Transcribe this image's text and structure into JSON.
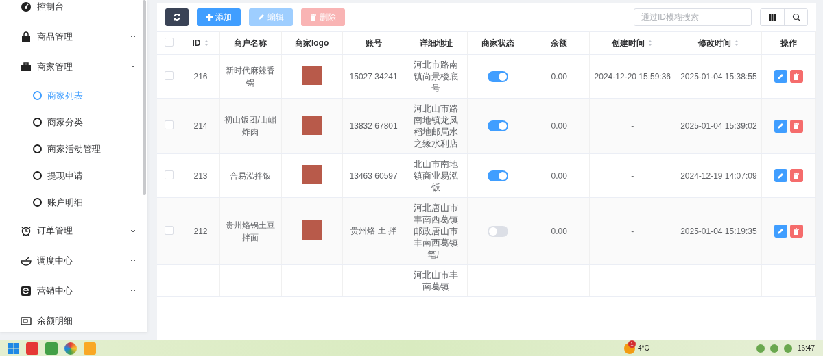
{
  "sidebar": {
    "items": [
      {
        "label": "控制台",
        "kind": "link"
      },
      {
        "label": "商品管理",
        "kind": "group",
        "expanded": false
      },
      {
        "label": "商家管理",
        "kind": "group",
        "expanded": true,
        "children": [
          {
            "label": "商家列表",
            "selected": true
          },
          {
            "label": "商家分类",
            "selected": false
          },
          {
            "label": "商家活动管理",
            "selected": false
          },
          {
            "label": "提现申请",
            "selected": false
          },
          {
            "label": "账户明细",
            "selected": false
          }
        ]
      },
      {
        "label": "订单管理",
        "kind": "group",
        "expanded": false
      },
      {
        "label": "调度中心",
        "kind": "group",
        "expanded": false
      },
      {
        "label": "营销中心",
        "kind": "group",
        "expanded": false
      },
      {
        "label": "余额明细",
        "kind": "link"
      }
    ]
  },
  "toolbar": {
    "buttons": [
      {
        "kind": "refresh",
        "disabled": false
      },
      {
        "kind": "add",
        "label": "添加",
        "disabled": false
      },
      {
        "kind": "edit",
        "label": "编辑",
        "disabled": true
      },
      {
        "kind": "delete",
        "label": "删除",
        "disabled": true
      }
    ],
    "search": {
      "placeholder": "通过ID模糊搜索"
    }
  },
  "table": {
    "select_all_checked": false,
    "columns": [
      {
        "label": "ID",
        "sortable": true
      },
      {
        "label": "商户名称",
        "sortable": false
      },
      {
        "label": "商家logo",
        "sortable": false
      },
      {
        "label": "账号",
        "sortable": false
      },
      {
        "label": "详细地址",
        "sortable": false
      },
      {
        "label": "商家状态",
        "sortable": false
      },
      {
        "label": "余额",
        "sortable": false
      },
      {
        "label": "创建时间",
        "sortable": true
      },
      {
        "label": "修改时间",
        "sortable": true
      },
      {
        "label": "操作",
        "sortable": false
      }
    ],
    "rows": [
      {
        "selected": false,
        "id": "216",
        "name": "新时代麻辣香锅",
        "account": "15027 34241",
        "address": "河北市路南镇尚景楼底号",
        "status_on": true,
        "balance": "0.00",
        "created": "2024-12-20 15:59:36",
        "modified": "2025-01-04 15:38:55"
      },
      {
        "selected": false,
        "id": "214",
        "name": "初山饭团/山嵋炸肉",
        "account": "13832 67801",
        "address": "河北山市路南地镇龙凤稻地邮局水之缘水利店",
        "status_on": true,
        "balance": "0.00",
        "created": "-",
        "modified": "2025-01-04 15:39:02"
      },
      {
        "selected": false,
        "id": "213",
        "name": "合易泓拌饭",
        "account": "13463 60597",
        "address": "北山市南地镇商业易泓饭",
        "status_on": true,
        "balance": "0.00",
        "created": "-",
        "modified": "2024-12-19 14:07:09"
      },
      {
        "selected": false,
        "id": "212",
        "name": "贵州烙锅土豆拌面",
        "account": "贵州烙 土 拌",
        "address": "河北唐山市丰南西葛镇邮政唐山市丰南西葛镇笔厂",
        "status_on": false,
        "balance": "0.00",
        "created": "-",
        "modified": "2025-01-04 15:19:35"
      },
      {
        "address": "河北山市丰南葛镇"
      }
    ]
  },
  "taskbar": {
    "weather": {
      "badge": "1",
      "temperature": "4°C"
    },
    "clock": "16:47"
  }
}
